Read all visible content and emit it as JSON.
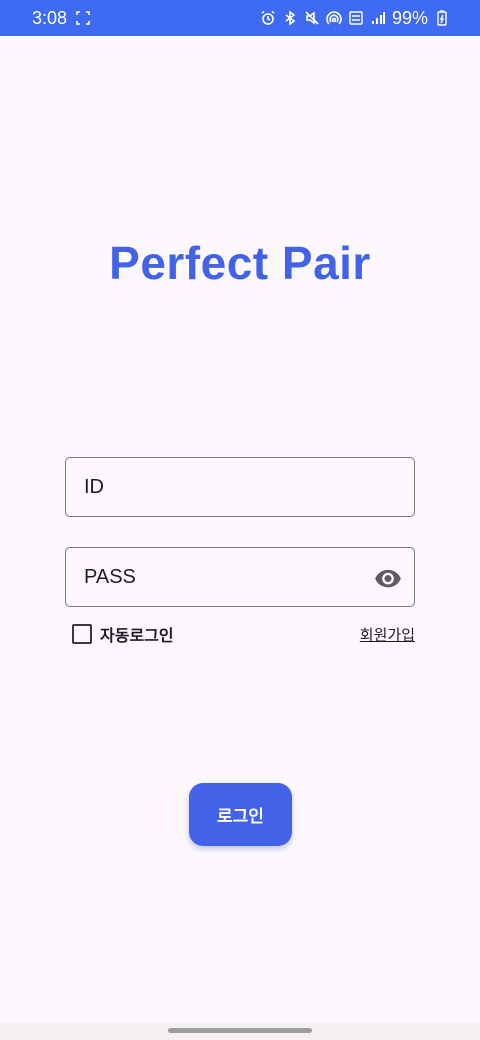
{
  "status_bar": {
    "time": "3:08",
    "battery": "99%",
    "color": "#3f6af3",
    "icons": [
      "screenshot-icon",
      "alarm-icon",
      "bluetooth-icon",
      "mute-icon",
      "hotspot-icon",
      "volte-icon",
      "signal-icon",
      "battery-charging-icon"
    ]
  },
  "app": {
    "title": "Perfect Pair",
    "accent_color": "#4262e8"
  },
  "form": {
    "id_placeholder": "ID",
    "pass_placeholder": "PASS",
    "auto_login_label": "자동로그인",
    "auto_login_checked": false,
    "signup_label": "회원가입",
    "login_label": "로그인"
  }
}
